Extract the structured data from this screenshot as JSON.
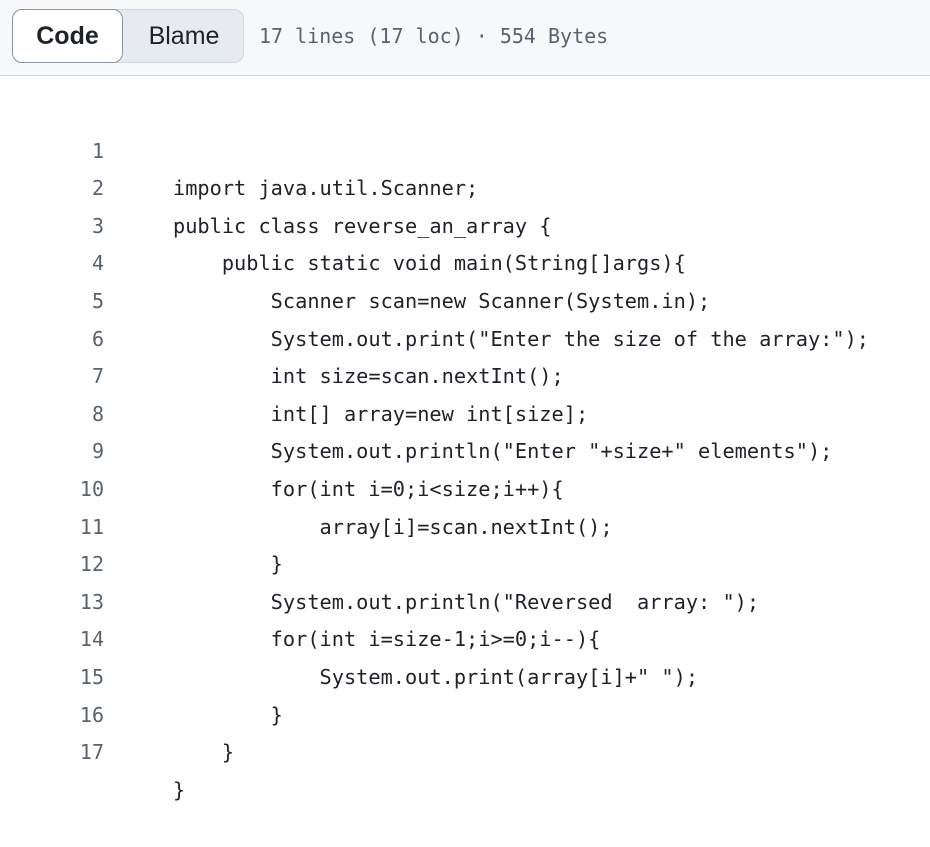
{
  "toolbar": {
    "code_label": "Code",
    "blame_label": "Blame",
    "file_info": "17 lines (17 loc) · 554 Bytes"
  },
  "code": {
    "lines": [
      {
        "num": "1",
        "text": "import java.util.Scanner;"
      },
      {
        "num": "2",
        "text": "public class reverse_an_array {"
      },
      {
        "num": "3",
        "text": "    public static void main(String[]args){"
      },
      {
        "num": "4",
        "text": "        Scanner scan=new Scanner(System.in);"
      },
      {
        "num": "5",
        "text": "        System.out.print(\"Enter the size of the array:\");"
      },
      {
        "num": "6",
        "text": "        int size=scan.nextInt();"
      },
      {
        "num": "7",
        "text": "        int[] array=new int[size];"
      },
      {
        "num": "8",
        "text": "        System.out.println(\"Enter \"+size+\" elements\");"
      },
      {
        "num": "9",
        "text": "        for(int i=0;i<size;i++){"
      },
      {
        "num": "10",
        "text": "            array[i]=scan.nextInt();"
      },
      {
        "num": "11",
        "text": "        }"
      },
      {
        "num": "12",
        "text": "        System.out.println(\"Reversed  array: \");"
      },
      {
        "num": "13",
        "text": "        for(int i=size-1;i>=0;i--){"
      },
      {
        "num": "14",
        "text": "            System.out.print(array[i]+\" \");"
      },
      {
        "num": "15",
        "text": "        }"
      },
      {
        "num": "16",
        "text": "    }"
      },
      {
        "num": "17",
        "text": "}"
      }
    ]
  }
}
